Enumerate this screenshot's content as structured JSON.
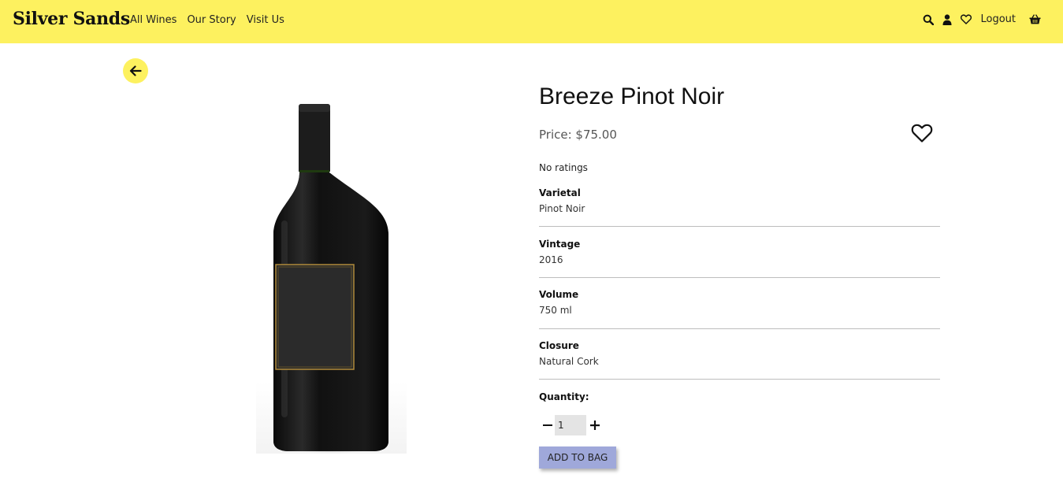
{
  "nav": {
    "brand": "Silver Sands",
    "links": [
      "All Wines",
      "Our Story",
      "Visit Us"
    ],
    "logout": "Logout",
    "icons": [
      "search-icon",
      "user-icon",
      "heart-icon",
      "basket-icon"
    ]
  },
  "product": {
    "name": "Breeze Pinot Noir",
    "price": "Price: $75.00",
    "ratings": "No ratings",
    "specs": [
      {
        "label": "Varietal",
        "value": "Pinot Noir"
      },
      {
        "label": "Vintage",
        "value": "2016"
      },
      {
        "label": "Volume",
        "value": "750 ml"
      },
      {
        "label": "Closure",
        "value": "Natural Cork"
      }
    ],
    "quantity_label": "Quantity:",
    "quantity_value": "1",
    "add_button": "ADD TO BAG"
  },
  "colors": {
    "brand_yellow": "#fdf15f",
    "button_lavender": "#9fa8da"
  }
}
